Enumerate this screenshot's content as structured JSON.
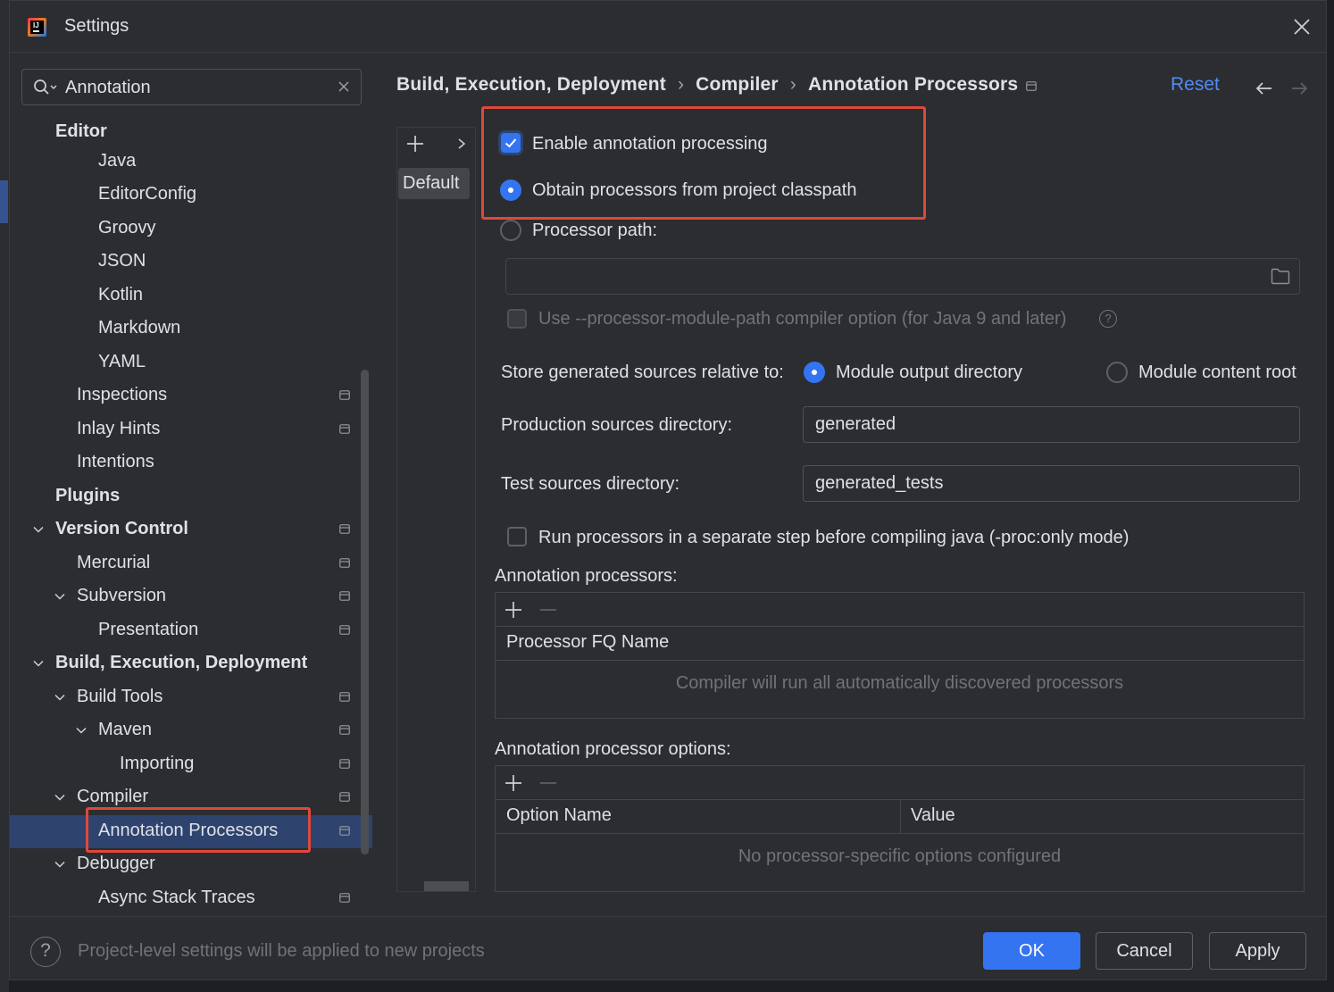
{
  "window": {
    "title": "Settings"
  },
  "search": {
    "value": "Annotation"
  },
  "sidebar": {
    "items": [
      {
        "label": "Editor"
      },
      {
        "label": "Java"
      },
      {
        "label": "EditorConfig"
      },
      {
        "label": "Groovy"
      },
      {
        "label": "JSON"
      },
      {
        "label": "Kotlin"
      },
      {
        "label": "Markdown"
      },
      {
        "label": "YAML"
      },
      {
        "label": "Inspections"
      },
      {
        "label": "Inlay Hints"
      },
      {
        "label": "Intentions"
      },
      {
        "label": "Plugins"
      },
      {
        "label": "Version Control"
      },
      {
        "label": "Mercurial"
      },
      {
        "label": "Subversion"
      },
      {
        "label": "Presentation"
      },
      {
        "label": "Build, Execution, Deployment"
      },
      {
        "label": "Build Tools"
      },
      {
        "label": "Maven"
      },
      {
        "label": "Importing"
      },
      {
        "label": "Compiler"
      },
      {
        "label": "Annotation Processors"
      },
      {
        "label": "Debugger"
      },
      {
        "label": "Async Stack Traces"
      }
    ]
  },
  "header": {
    "breadcrumb": [
      "Build, Execution, Deployment",
      "Compiler",
      "Annotation Processors"
    ],
    "breadcrumb_sep": "›",
    "reset_label": "Reset"
  },
  "profiles": {
    "default_label": "Default"
  },
  "options": {
    "enable_processing_label": "Enable annotation processing",
    "enable_processing_checked": true,
    "obtain_classpath_label": "Obtain processors from project classpath",
    "processor_path_label": "Processor path:",
    "processor_path_value": "",
    "module_path_label": "Use --processor-module-path compiler option (for Java 9 and later)",
    "module_path_help": "?",
    "store_relative_label": "Store generated sources relative to:",
    "module_output_label": "Module output directory",
    "module_content_label": "Module content root",
    "production_dir_label": "Production sources directory:",
    "production_dir_value": "generated",
    "test_dir_label": "Test sources directory:",
    "test_dir_value": "generated_tests",
    "proc_only_label": "Run processors in a separate step before compiling java (-proc:only mode)"
  },
  "processors_table": {
    "title": "Annotation processors:",
    "column": "Processor FQ Name",
    "empty_text": "Compiler will run all automatically discovered processors"
  },
  "options_table": {
    "title": "Annotation processor options:",
    "columns": [
      "Option Name",
      "Value"
    ],
    "empty_text": "No processor-specific options configured"
  },
  "footer": {
    "help": "?",
    "note": "Project-level settings will be applied to new projects",
    "ok_label": "OK",
    "cancel_label": "Cancel",
    "apply_label": "Apply"
  },
  "colors": {
    "accent": "#3574f0",
    "link": "#548af7",
    "highlight_box": "#e0483a",
    "selection": "#2e436e",
    "background": "#2b2d30"
  },
  "icons": [
    "app-logo-icon",
    "close-icon",
    "search-icon",
    "clear-icon",
    "chevron-down-icon",
    "pin-icon",
    "arrow-left-icon",
    "arrow-right-icon",
    "plus-icon",
    "minus-icon",
    "chevron-right-icon",
    "folder-icon",
    "help-icon"
  ]
}
